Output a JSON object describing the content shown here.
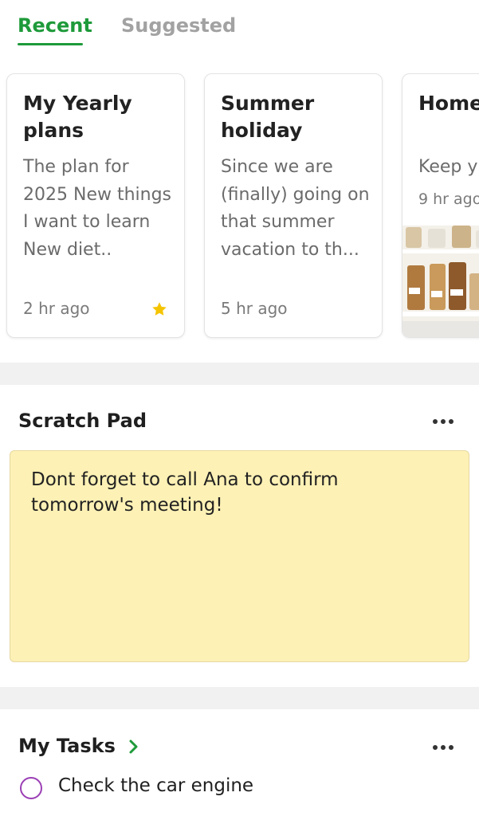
{
  "tabs": [
    {
      "label": "Recent",
      "active": true
    },
    {
      "label": "Suggested",
      "active": false
    }
  ],
  "cards": [
    {
      "title": "My Yearly plans",
      "body": "The plan for 2025 New things I want to learn New diet..",
      "time": "2 hr ago",
      "starred": true
    },
    {
      "title": "Summer holiday",
      "body": "Since we are (finally) going on that summer vacation to th...",
      "time": "5 hr ago",
      "starred": false
    },
    {
      "title": "Home Check",
      "body": "Keep y",
      "time": "9 hr ago",
      "starred": false,
      "has_image": true
    }
  ],
  "scratch_pad": {
    "title": "Scratch Pad",
    "text": "Dont forget to call Ana to confirm tomorrow's meeting!"
  },
  "tasks": {
    "title": "My Tasks",
    "items": [
      {
        "label": "Check the car engine",
        "done": false
      }
    ]
  },
  "colors": {
    "accent": "#1e9a3a",
    "scratch_bg": "#fdf1b5",
    "star": "#f5c400",
    "task_circle": "#9b3fb5"
  }
}
